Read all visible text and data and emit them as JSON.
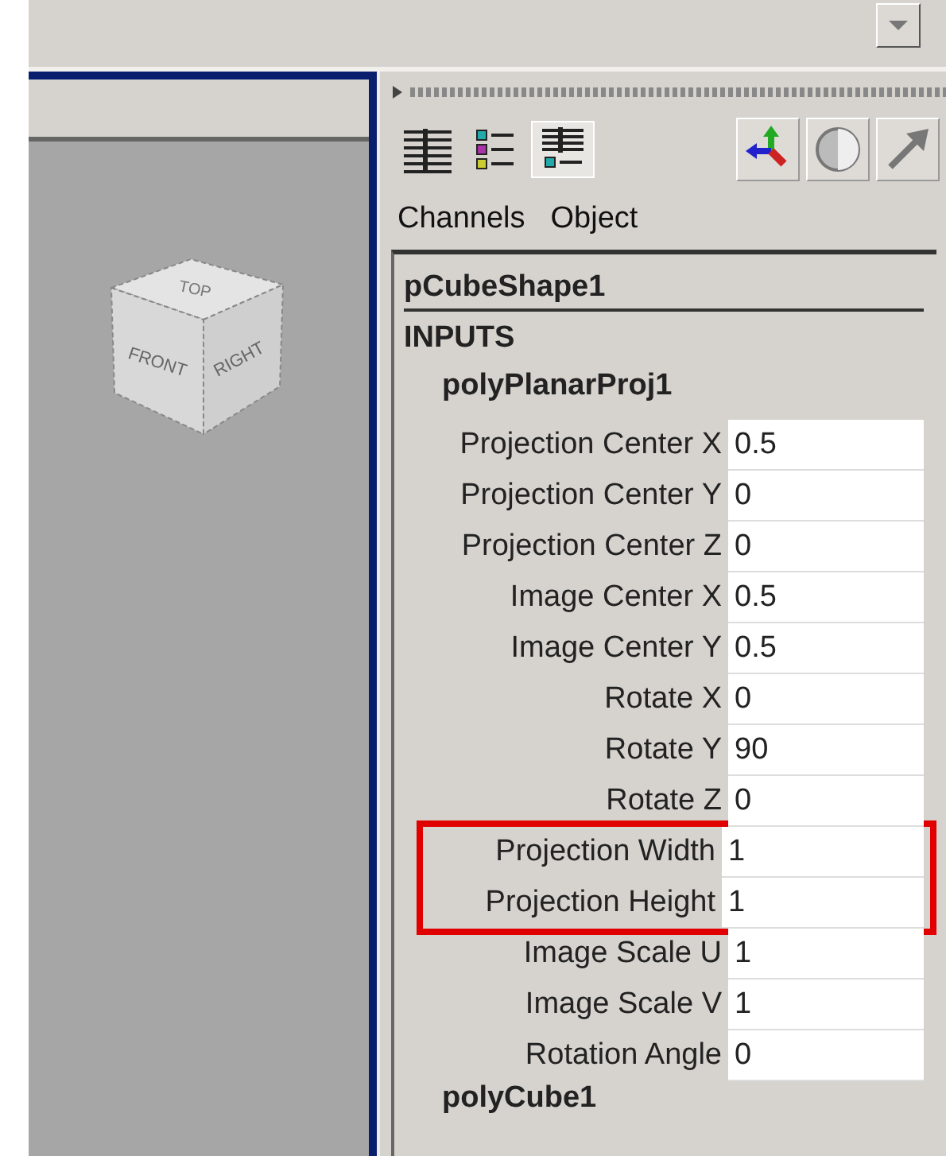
{
  "viewcube": {
    "faces": [
      "TOP",
      "FRONT",
      "RIGHT"
    ]
  },
  "menu": [
    {
      "label": "Channels"
    },
    {
      "label": "Object"
    }
  ],
  "channel_box": {
    "object": "pCubeShape1",
    "section": "INPUTS",
    "node": "polyPlanarProj1",
    "attributes": [
      {
        "label": "Projection Center X",
        "value": "0.5",
        "highlighted": false
      },
      {
        "label": "Projection Center Y",
        "value": "0",
        "highlighted": false
      },
      {
        "label": "Projection Center Z",
        "value": "0",
        "highlighted": false
      },
      {
        "label": "Image Center X",
        "value": "0.5",
        "highlighted": false
      },
      {
        "label": "Image Center Y",
        "value": "0.5",
        "highlighted": false
      },
      {
        "label": "Rotate X",
        "value": "0",
        "highlighted": false
      },
      {
        "label": "Rotate Y",
        "value": "90",
        "highlighted": false
      },
      {
        "label": "Rotate Z",
        "value": "0",
        "highlighted": false
      },
      {
        "label": "Projection Width",
        "value": "1",
        "highlighted": true
      },
      {
        "label": "Projection Height",
        "value": "1",
        "highlighted": true
      },
      {
        "label": "Image Scale U",
        "value": "1",
        "highlighted": false
      },
      {
        "label": "Image Scale V",
        "value": "1",
        "highlighted": false
      },
      {
        "label": "Rotation Angle",
        "value": "0",
        "highlighted": false
      }
    ],
    "next_node": "polyCube1"
  }
}
